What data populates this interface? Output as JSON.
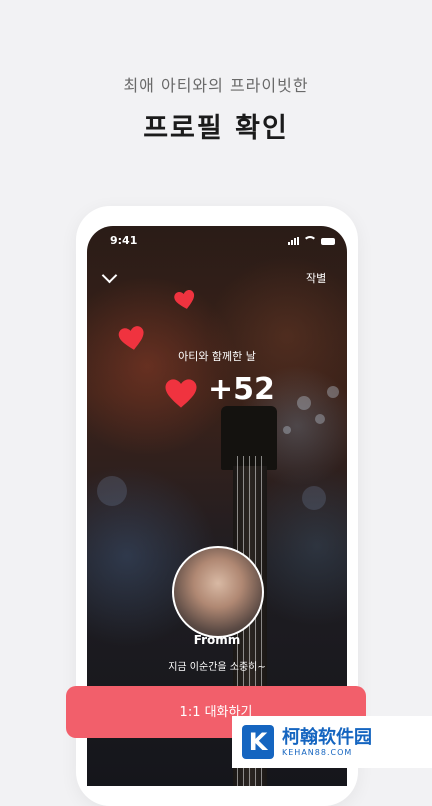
{
  "header": {
    "subtitle": "최애 아티와의 프라이빗한",
    "title": "프로필 확인"
  },
  "phone": {
    "status_time": "9:41",
    "farewell_label": "작별",
    "days_label": "아티와 함께한 날",
    "days_count": "+52",
    "artist_name": "Fromm",
    "artist_status": "지금 이순간을 소중히~"
  },
  "chat_button_label": "1:1 대화하기",
  "watermark": {
    "title": "柯翰软件园",
    "subtitle": "KEHAN88.COM",
    "logo_letter": "K"
  },
  "colors": {
    "accent": "#f25f6b",
    "heart": "#f0333f"
  },
  "icons": [
    "chevron-down-icon",
    "heart-icon",
    "signal-icon",
    "wifi-icon",
    "battery-icon"
  ]
}
